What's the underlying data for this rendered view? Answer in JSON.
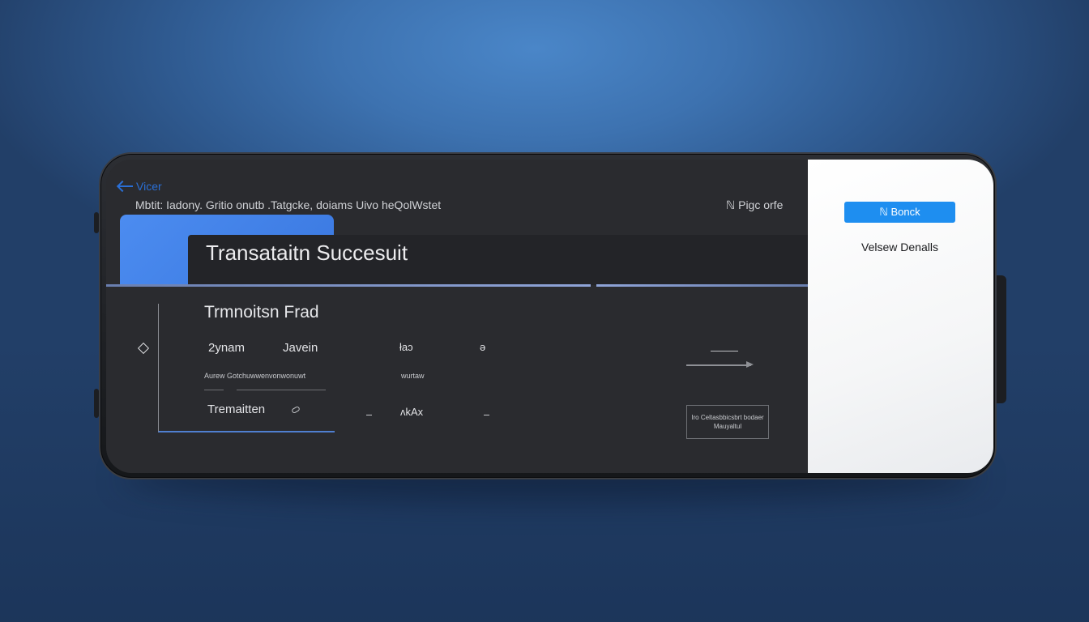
{
  "header": {
    "back_label": "Vicer",
    "breadcrumb": "Mbtit: Iadony. Gritio onutb .Tatgcke, doiams Uivo heQolWstet",
    "page_ref": "ℕ Pigc orfe"
  },
  "main": {
    "title": "Transataitn Succesuit",
    "section_title": "Trmnoitsn Frad",
    "row1": [
      "2ynam",
      "Javein",
      "łaɔ",
      "ə"
    ],
    "subrow_left": "Aurew Gotchuwwenvonwonuwt",
    "subrow_right": "wurtaw",
    "row2_label": "Tremaitten",
    "row2_value": "ʌkAx",
    "note_lines": [
      "Iro Celtasbbicsbrt bodaer",
      "Mauyaltul"
    ]
  },
  "side_panel": {
    "primary_button": "ℕ Bonck",
    "details_link": "Velsew Denalls"
  },
  "colors": {
    "accent": "#1e8ef0",
    "tab_blue": "#4c8cf0",
    "dark_bg": "#2a2b2f",
    "divider": "#7c93c9"
  },
  "icons": {
    "back": "arrow-left-icon",
    "diamond": "diamond-icon",
    "link": "link-icon",
    "arrow": "arrow-right-icon"
  }
}
